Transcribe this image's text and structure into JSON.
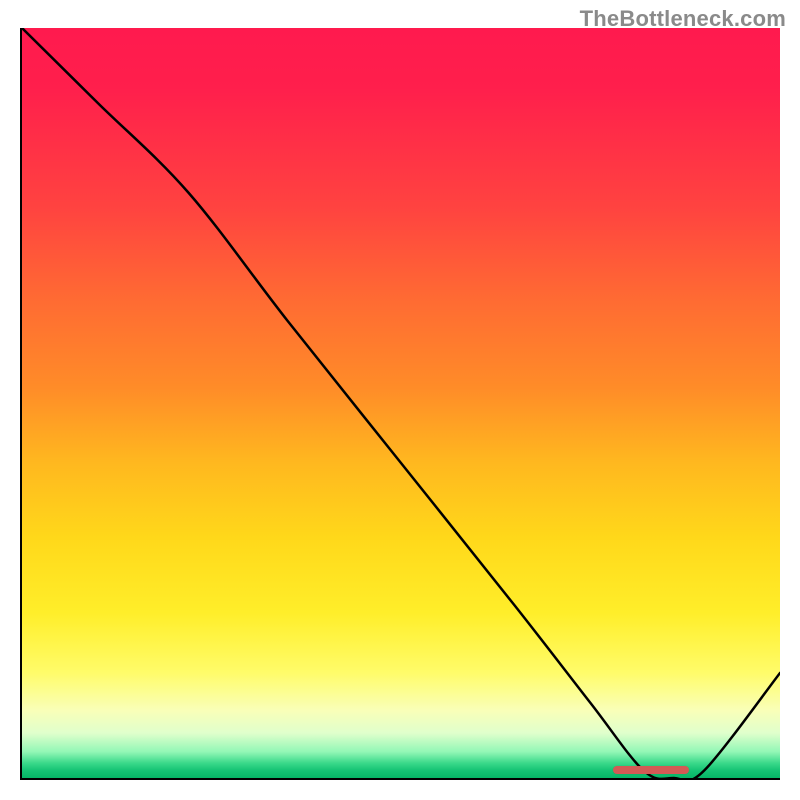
{
  "watermark": "TheBottleneck.com",
  "chart_data": {
    "type": "line",
    "title": "",
    "xlabel": "",
    "ylabel": "",
    "xlim": [
      0,
      100
    ],
    "ylim": [
      0,
      100
    ],
    "grid": false,
    "legend": false,
    "series": [
      {
        "name": "bottleneck-curve",
        "x": [
          0,
          10,
          22,
          35,
          50,
          65,
          75,
          82,
          86,
          90,
          100
        ],
        "values": [
          100,
          90,
          78,
          61,
          42,
          23,
          10,
          1,
          0,
          1,
          14
        ]
      }
    ],
    "annotations": [
      {
        "name": "optimal-range-marker",
        "x_start": 78,
        "x_end": 88,
        "y": 0
      }
    ],
    "background_gradient": {
      "top": "#ff1a4e",
      "middle": "#ffee2a",
      "bottom": "#06b566"
    }
  }
}
